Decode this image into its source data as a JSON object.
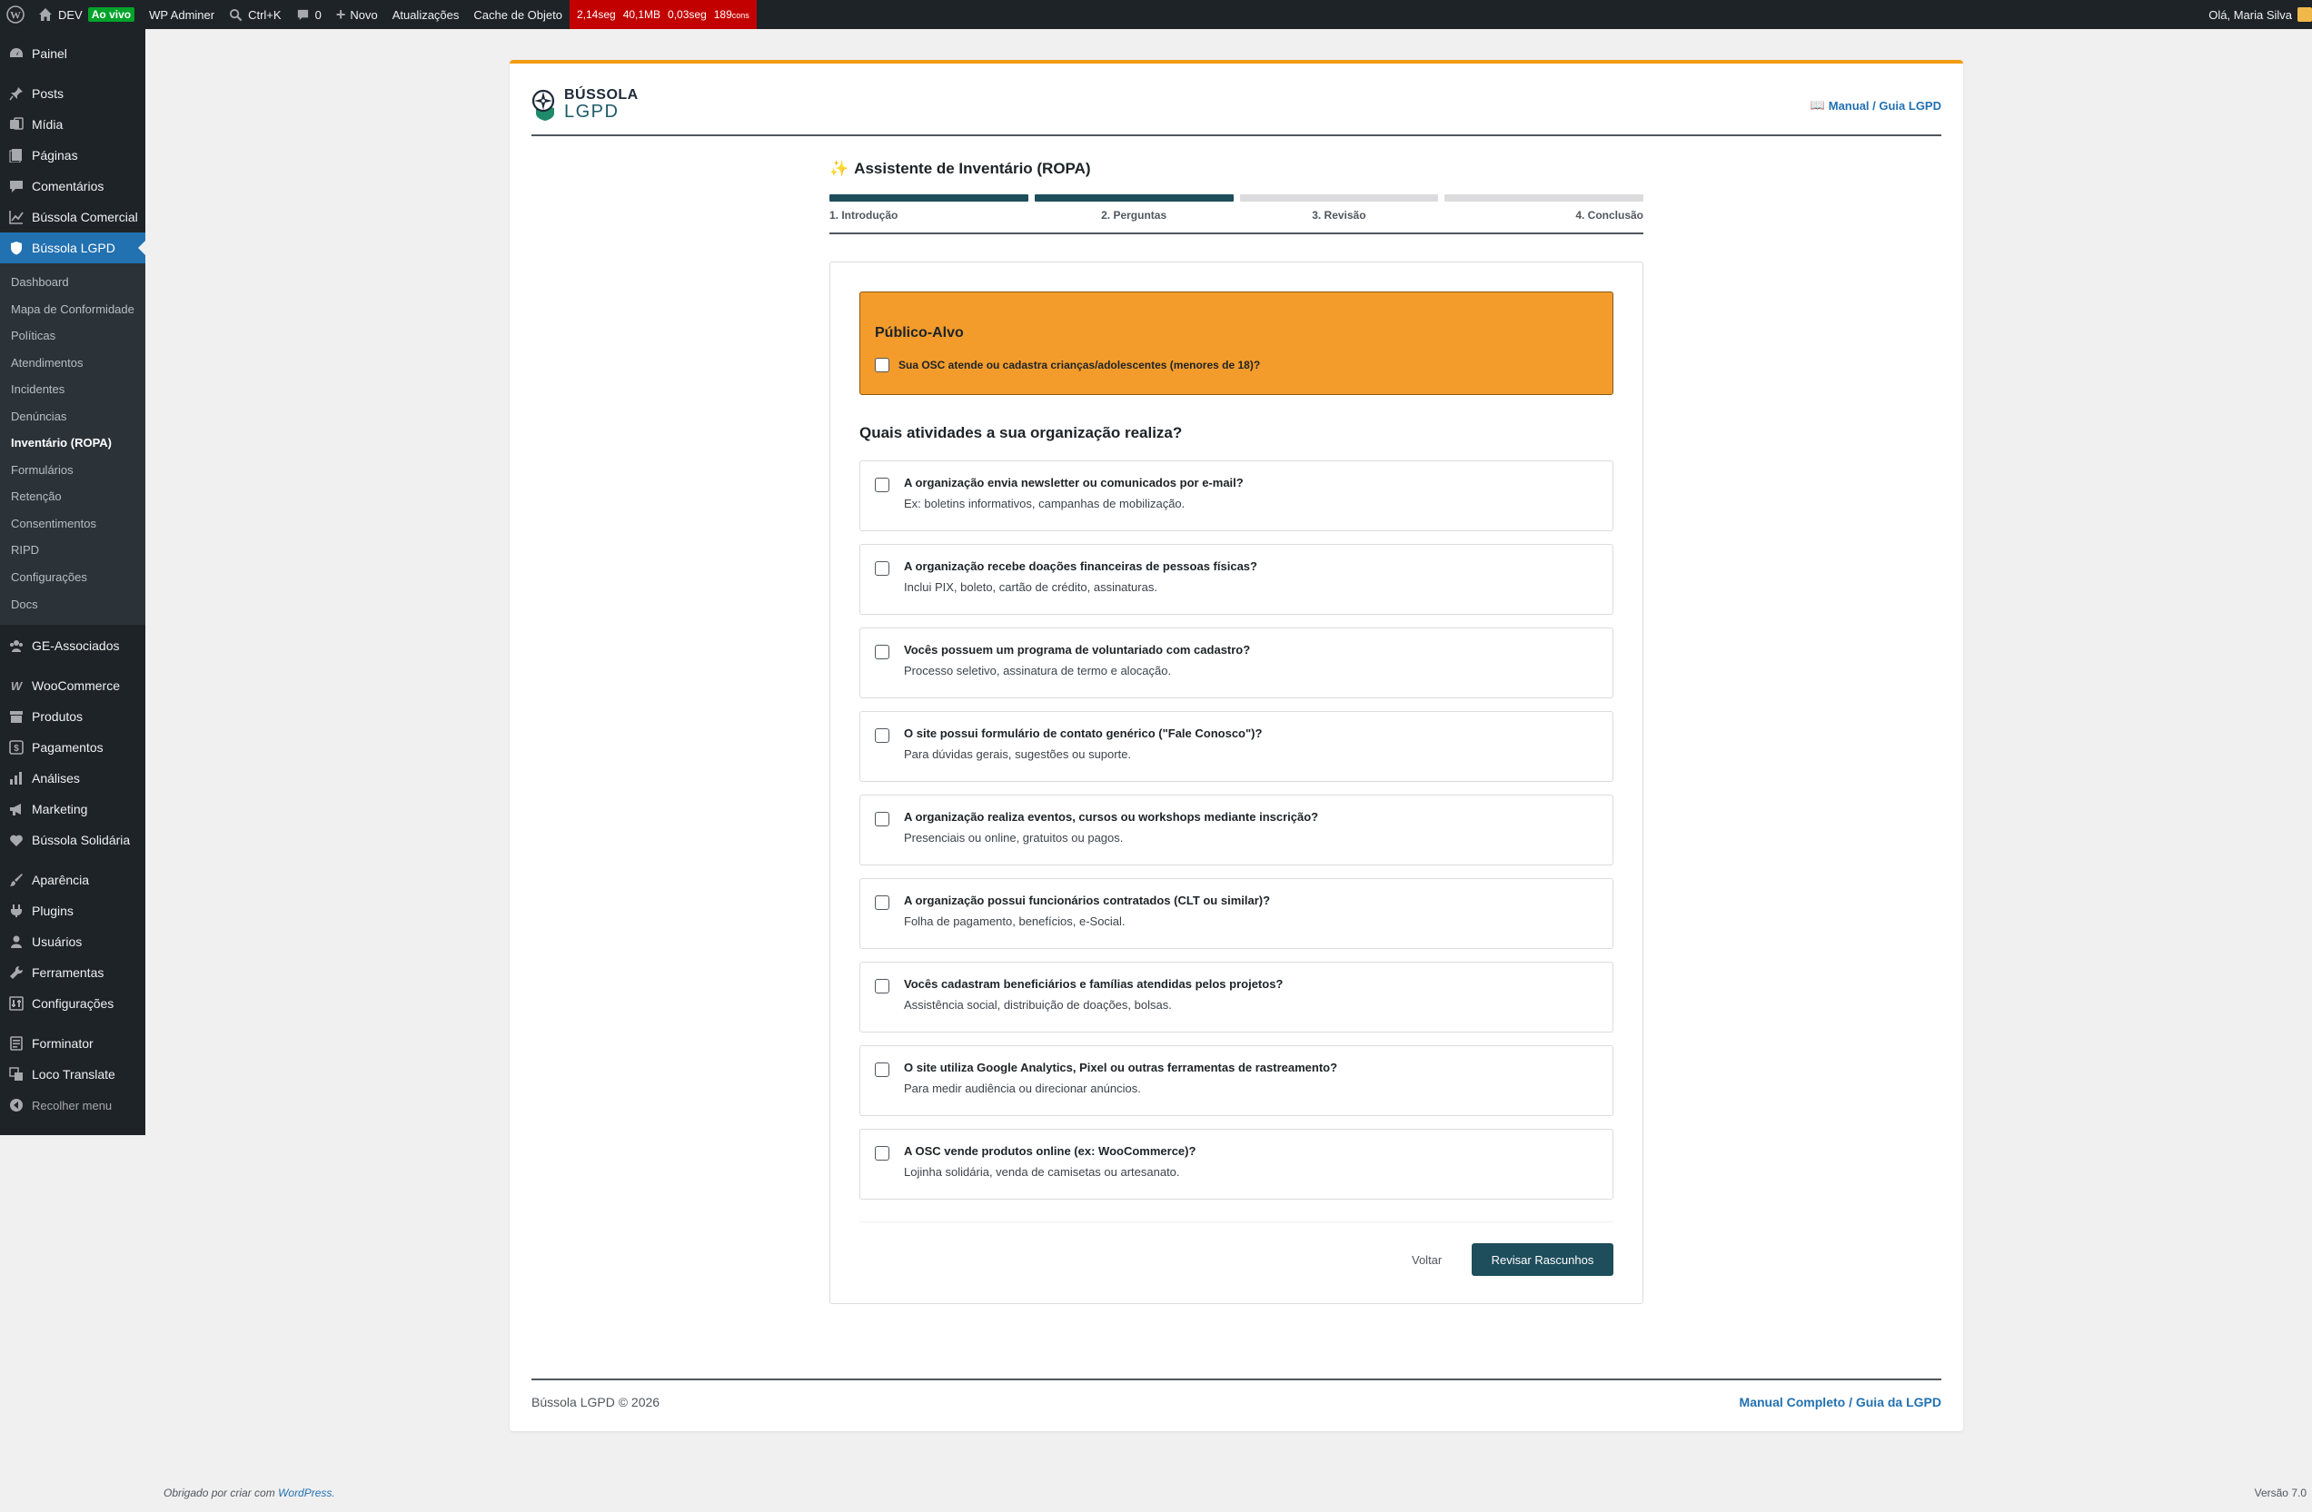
{
  "adminbar": {
    "site_name": "DEV",
    "live_badge": "Ao vivo",
    "wp_adminer": "WP Adminer",
    "command": "Ctrl+K",
    "comments_count": "0",
    "new_label": "Novo",
    "updates": "Atualizações",
    "cache": "Cache de Objeto",
    "qm_time": "2,14seg",
    "qm_mem": "40,1MB",
    "qm_db": "0,03seg",
    "qm_queries": "189",
    "qm_queries_unit": "cons",
    "greeting": "Olá, Maria Silva"
  },
  "sidebar": {
    "top": [
      {
        "label": "Painel",
        "icon": "dashboard-icon"
      }
    ],
    "group1": [
      {
        "label": "Posts",
        "icon": "pin-icon"
      },
      {
        "label": "Mídia",
        "icon": "media-icon"
      },
      {
        "label": "Páginas",
        "icon": "pages-icon"
      },
      {
        "label": "Comentários",
        "icon": "comments-icon"
      },
      {
        "label": "Bússola Comercial",
        "icon": "chart-icon"
      },
      {
        "label": "Bússola LGPD",
        "icon": "shield-icon"
      }
    ],
    "submenu": [
      "Dashboard",
      "Mapa de Conformidade",
      "Políticas",
      "Atendimentos",
      "Incidentes",
      "Denúncias",
      "Inventário (ROPA)",
      "Formulários",
      "Retenção",
      "Consentimentos",
      "RIPD",
      "Configurações",
      "Docs"
    ],
    "group2": [
      {
        "label": "GE-Associados",
        "icon": "groups-icon"
      }
    ],
    "group3": [
      {
        "label": "WooCommerce",
        "icon": "woo-icon"
      },
      {
        "label": "Produtos",
        "icon": "archive-icon"
      },
      {
        "label": "Pagamentos",
        "icon": "dollar-icon"
      },
      {
        "label": "Análises",
        "icon": "bar-chart-icon"
      },
      {
        "label": "Marketing",
        "icon": "megaphone-icon"
      },
      {
        "label": "Bússola Solidária",
        "icon": "heart-icon"
      }
    ],
    "group4": [
      {
        "label": "Aparência",
        "icon": "brush-icon"
      },
      {
        "label": "Plugins",
        "icon": "plugin-icon"
      },
      {
        "label": "Usuários",
        "icon": "users-icon"
      },
      {
        "label": "Ferramentas",
        "icon": "wrench-icon"
      },
      {
        "label": "Configurações",
        "icon": "settings-icon"
      }
    ],
    "group5": [
      {
        "label": "Forminator",
        "icon": "form-icon"
      },
      {
        "label": "Loco Translate",
        "icon": "translate-icon"
      }
    ],
    "collapse": "Recolher menu"
  },
  "header": {
    "logo_line1": "BÚSSOLA",
    "logo_line2": "LGPD",
    "manual_link": "Manual / Guia LGPD"
  },
  "wizard": {
    "title": "Assistente de Inventário (ROPA)",
    "steps": [
      {
        "label": "1. Introdução",
        "done": true
      },
      {
        "label": "2. Perguntas",
        "done": true
      },
      {
        "label": "3. Revisão",
        "done": false
      },
      {
        "label": "4. Conclusão",
        "done": false
      }
    ]
  },
  "audience": {
    "title": "Público-Alvo",
    "question": "Sua OSC atende ou cadastra crianças/adolescentes (menores de 18)?"
  },
  "activities": {
    "title": "Quais atividades a sua organização realiza?",
    "items": [
      {
        "title": "A organização envia newsletter ou comunicados por e-mail?",
        "desc": "Ex: boletins informativos, campanhas de mobilização."
      },
      {
        "title": "A organização recebe doações financeiras de pessoas físicas?",
        "desc": "Inclui PIX, boleto, cartão de crédito, assinaturas."
      },
      {
        "title": "Vocês possuem um programa de voluntariado com cadastro?",
        "desc": "Processo seletivo, assinatura de termo e alocação."
      },
      {
        "title": "O site possui formulário de contato genérico (\"Fale Conosco\")?",
        "desc": "Para dúvidas gerais, sugestões ou suporte."
      },
      {
        "title": "A organização realiza eventos, cursos ou workshops mediante inscrição?",
        "desc": "Presenciais ou online, gratuitos ou pagos."
      },
      {
        "title": "A organização possui funcionários contratados (CLT ou similar)?",
        "desc": "Folha de pagamento, benefícios, e-Social."
      },
      {
        "title": "Vocês cadastram beneficiários e famílias atendidas pelos projetos?",
        "desc": "Assistência social, distribuição de doações, bolsas."
      },
      {
        "title": "O site utiliza Google Analytics, Pixel ou outras ferramentas de rastreamento?",
        "desc": "Para medir audiência ou direcionar anúncios."
      },
      {
        "title": "A OSC vende produtos online (ex: WooCommerce)?",
        "desc": "Lojinha solidária, venda de camisetas ou artesanato."
      }
    ]
  },
  "actions": {
    "back": "Voltar",
    "review": "Revisar Rascunhos"
  },
  "footer": {
    "copyright": "Bússola LGPD © 2026",
    "manual": "Manual Completo / Guia da LGPD"
  },
  "wp_footer": {
    "thanks": "Obrigado por criar com",
    "wordpress": "WordPress.",
    "version": "Versão 7.0"
  }
}
